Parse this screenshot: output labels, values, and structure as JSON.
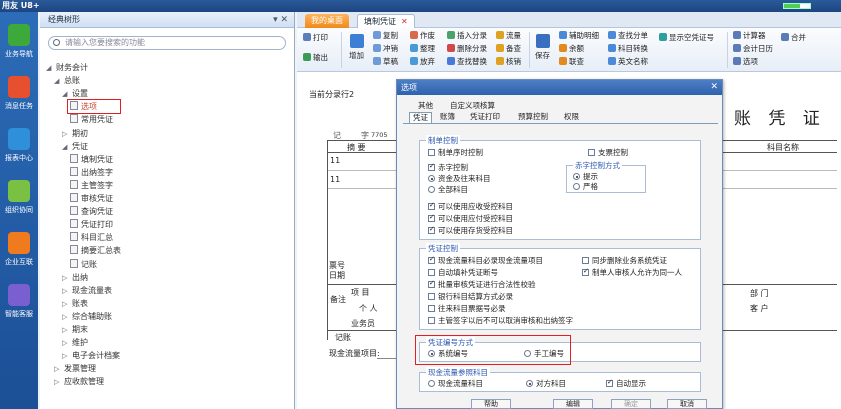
{
  "brand": "用友 U8+",
  "nav": [
    {
      "label": "业务导航",
      "color": "#3ca93a"
    },
    {
      "label": "消息任务",
      "color": "#e7502f"
    },
    {
      "label": "报表中心",
      "color": "#2f8fd8"
    },
    {
      "label": "组织协同",
      "color": "#7ac043"
    },
    {
      "label": "企业互联",
      "color": "#f07a1e"
    },
    {
      "label": "智能客服",
      "color": "#7a5fd1"
    }
  ],
  "tree": {
    "header": "经典树形",
    "pins": "▾ ✕",
    "search_placeholder": "请输入您要搜索的功能",
    "items": [
      {
        "label": "财务会计",
        "arrow": "◢"
      },
      {
        "label": "总账",
        "arrow": "◢"
      },
      {
        "label": "设置",
        "arrow": "◢"
      },
      {
        "label": "选项",
        "file": true,
        "highlight": true
      },
      {
        "label": "常用凭证",
        "file": true
      },
      {
        "label": "期初",
        "arrow": "▷"
      },
      {
        "label": "凭证",
        "arrow": "◢"
      },
      {
        "label": "填制凭证",
        "file": true
      },
      {
        "label": "出纳签字",
        "file": true
      },
      {
        "label": "主管签字",
        "file": true
      },
      {
        "label": "审核凭证",
        "file": true
      },
      {
        "label": "查询凭证",
        "file": true
      },
      {
        "label": "凭证打印",
        "file": true
      },
      {
        "label": "科目汇总",
        "file": true
      },
      {
        "label": "摘要汇总表",
        "file": true
      },
      {
        "label": "记账",
        "file": true
      },
      {
        "label": "出纳",
        "arrow": "▷"
      },
      {
        "label": "现金流量表",
        "arrow": "▷"
      },
      {
        "label": "账表",
        "arrow": "▷"
      },
      {
        "label": "综合辅助账",
        "arrow": "▷"
      },
      {
        "label": "期末",
        "arrow": "▷"
      },
      {
        "label": "维护",
        "arrow": "▷"
      },
      {
        "label": "电子会计档案",
        "arrow": "▷"
      },
      {
        "label": "发票管理",
        "arrow": "▷"
      },
      {
        "label": "应收款管理",
        "arrow": "▷"
      }
    ]
  },
  "tabs": [
    {
      "label": "我的桌面"
    },
    {
      "label": "填制凭证",
      "close": "✕"
    }
  ],
  "toolbar": {
    "print": "打印",
    "output": "输出",
    "add": "增加",
    "save": "保存",
    "copy": "复制",
    "offset": "冲销",
    "draft": "草稿",
    "void": "作废",
    "tidy": "整理",
    "abandon": "放弃",
    "insert_row": "插入分录",
    "delete_row": "删除分录",
    "flow": "流量",
    "spare": "备查",
    "find_replace": "查找替换",
    "verify": "核销",
    "aux_detail": "辅助明细",
    "balance": "余额",
    "query": "联查",
    "find_entry": "查找分单",
    "subject_switch": "科目转换",
    "english": "英文名称",
    "show_blank": "显示空凭证号",
    "calculator": "计算器",
    "acc_calendar": "会计日历",
    "options": "选项",
    "merge": "合并"
  },
  "voucher": {
    "current_entry": "当前分录行2",
    "title": "账 凭 证",
    "ji": "记",
    "zi": "字",
    "num": "7705",
    "col_summary": "摘 要",
    "col_subject": "科目名称",
    "row1": "11",
    "row2": "11",
    "ticket_no": "票号",
    "date": "日期",
    "remark": "备注",
    "item": "项 目",
    "person": "个 人",
    "salesman": "业务员",
    "dept": "部 门",
    "customer": "客 户",
    "bookkeep": "记账",
    "cashflow": "现金流量项目:"
  },
  "dialog": {
    "title": "选项",
    "close": "✕",
    "tabs_row1": [
      "其他",
      "自定义项核算"
    ],
    "tabs_row2": [
      "凭证",
      "账簿",
      "凭证打印",
      "预算控制",
      "权限"
    ],
    "g1_label": "制单控制",
    "g1": {
      "serial": "制单序时控制",
      "check": "支票控制",
      "red": "赤字控制",
      "funds": "资金及往来科目",
      "all": "全部科目",
      "ar": "可以使用应收受控科目",
      "ap": "可以使用应付受控科目",
      "inv": "可以使用存货受控科目",
      "red_mode": "赤字控制方式",
      "prompt": "提示",
      "strict": "严格"
    },
    "g2_label": "凭证控制",
    "g2": {
      "c1": "现金流量科目必录现金流量项目",
      "c2": "同步删除业务系统凭证",
      "c3": "自动填补凭证断号",
      "c4": "制单人审核人允许为同一人",
      "c5": "批量审核凭证进行合法性校验",
      "c6": "银行科目结算方式必录",
      "c7": "往来科目票据号必录",
      "c8": "主管签字以后不可以取消审核和出纳签字"
    },
    "g3_label": "凭证编号方式",
    "g3": {
      "sys": "系统编号",
      "manual": "手工编号"
    },
    "g4_label": "现金流量参照科目",
    "g4": {
      "cash": "现金流量科目",
      "opp": "对方科目",
      "auto": "自动显示"
    },
    "buttons": [
      "帮助",
      "编辑",
      "确定",
      "取消"
    ]
  }
}
